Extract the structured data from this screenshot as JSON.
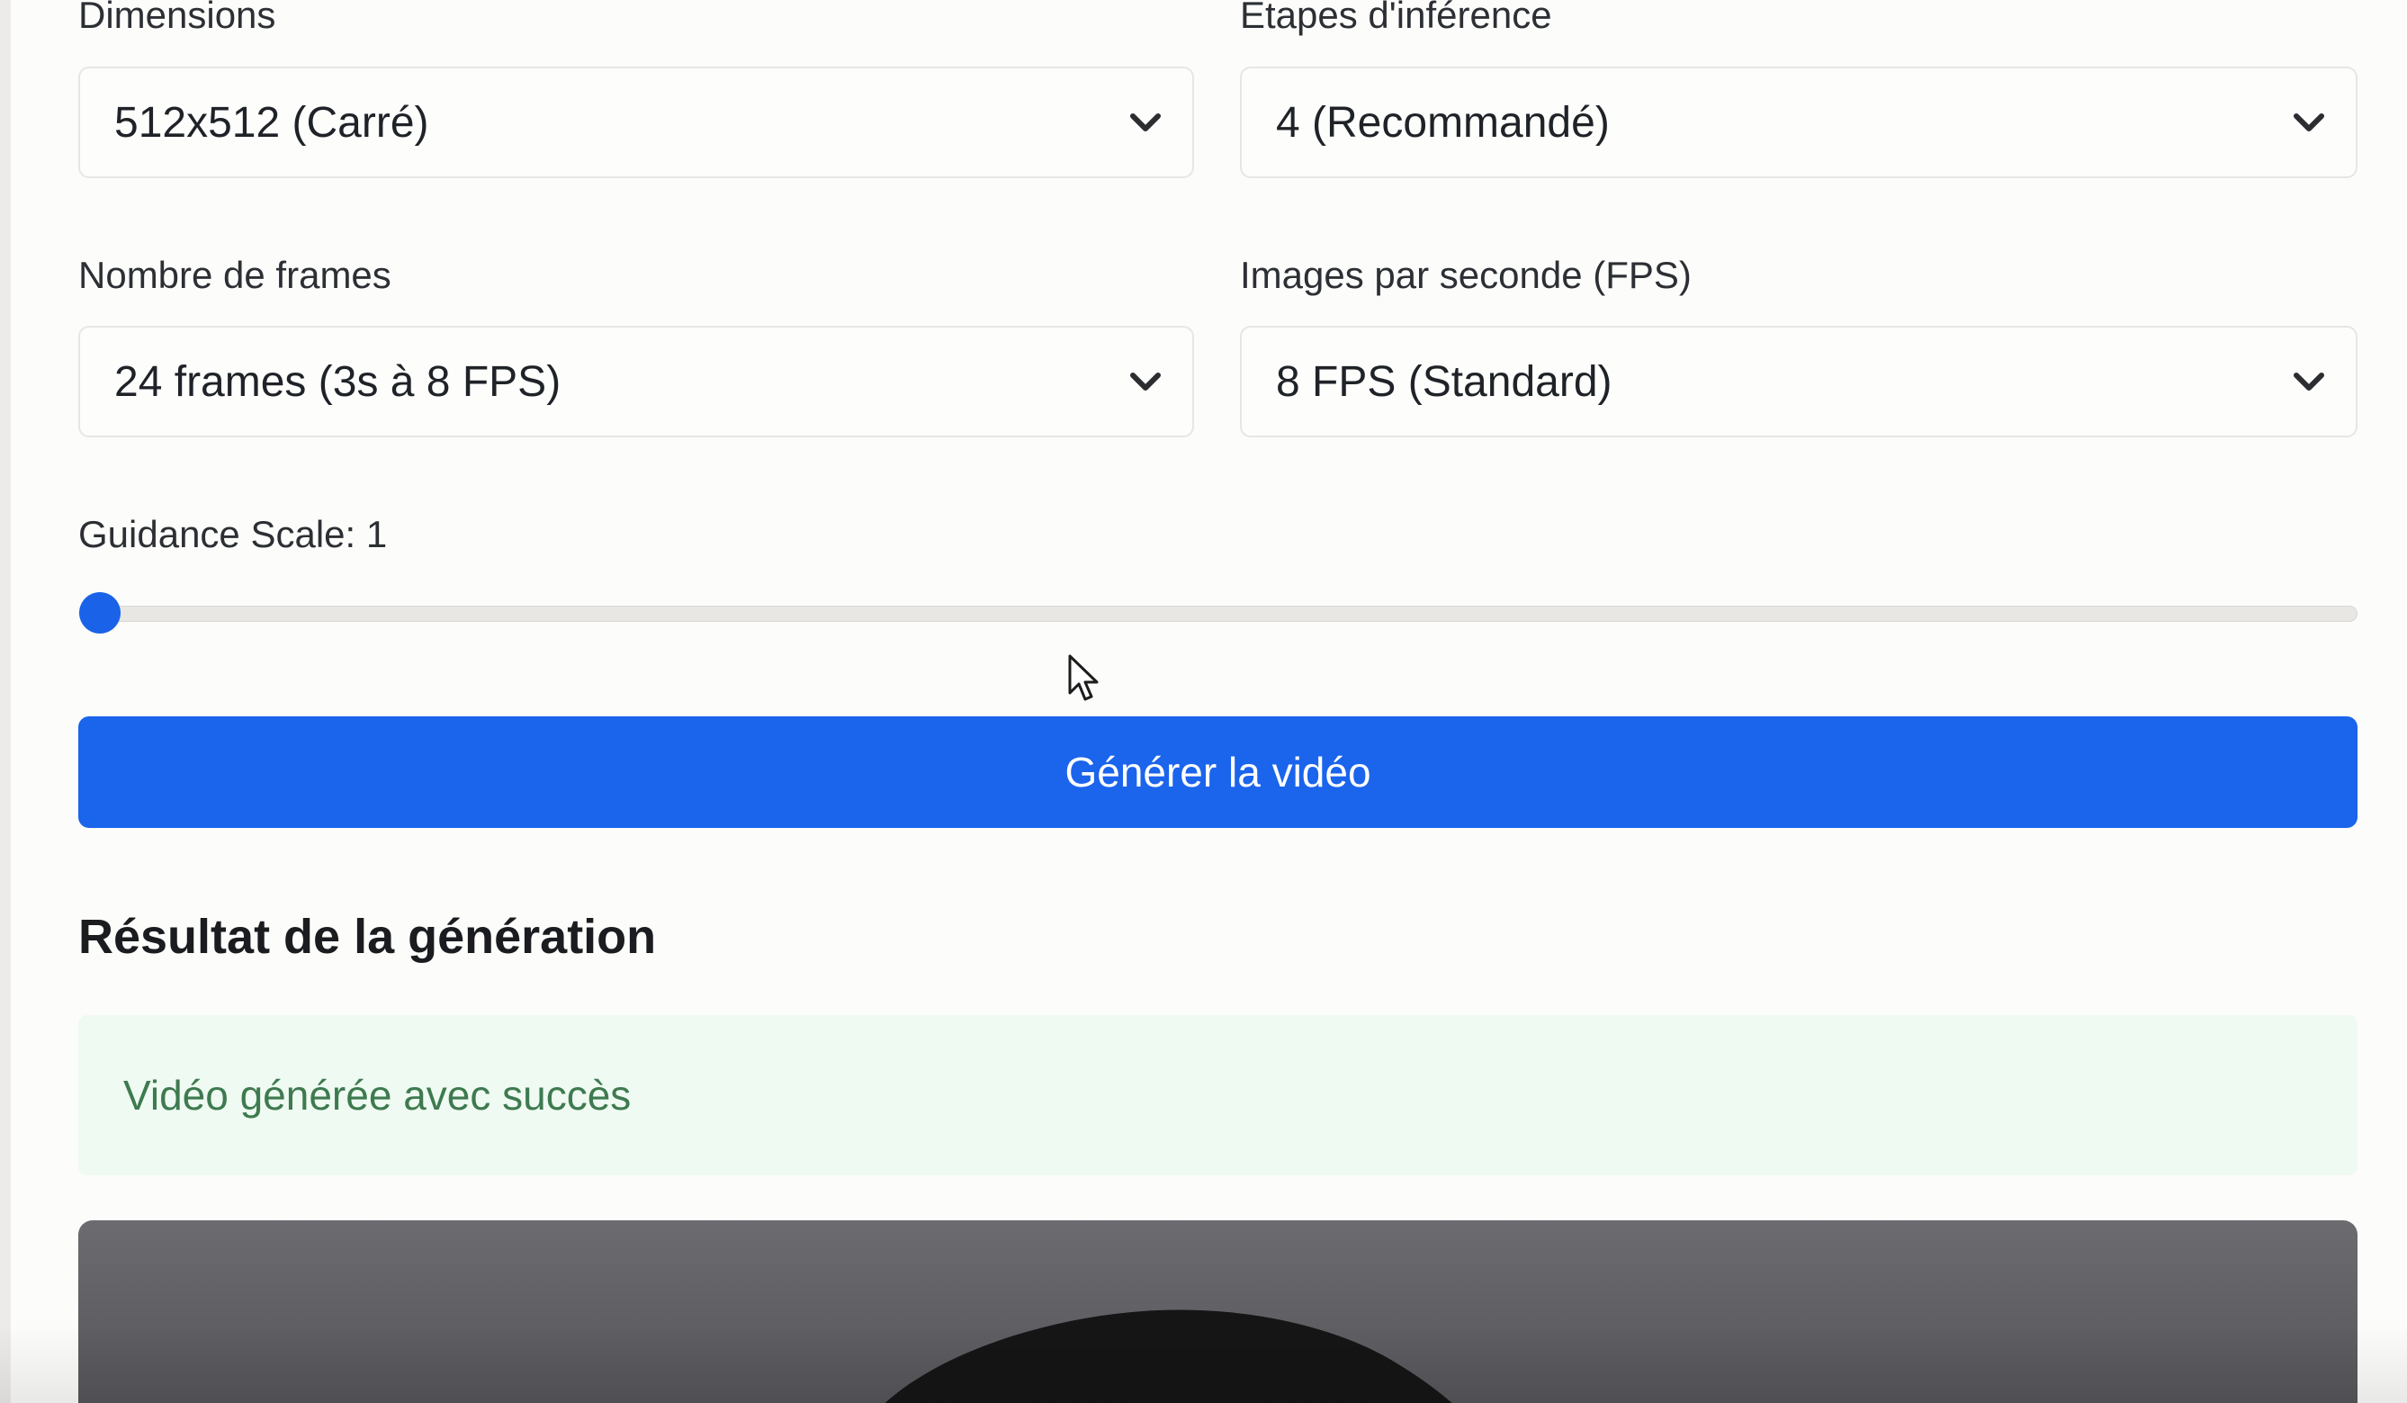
{
  "form": {
    "dimensions": {
      "label": "Dimensions",
      "value": "512x512 (Carré)"
    },
    "steps": {
      "label": "Étapes d'inférence",
      "value": "4 (Recommandé)"
    },
    "frames": {
      "label": "Nombre de frames",
      "value": "24 frames (3s à 8 FPS)"
    },
    "fps": {
      "label": "Images par seconde (FPS)",
      "value": "8 FPS (Standard)"
    },
    "guidance": {
      "label": "Guidance Scale: 1",
      "value": 1,
      "fill_fraction": 0.0
    },
    "generate_label": "Générer la vidéo"
  },
  "result": {
    "title": "Résultat de la génération",
    "status": "Vidéo générée avec succès"
  },
  "icons": {
    "select_arrow": "chevron-down-icon",
    "pointer": "cursor-icon"
  },
  "colors": {
    "primary": "#1b64ec",
    "success_bg": "#effaf2",
    "success_text": "#3e7a4f"
  }
}
